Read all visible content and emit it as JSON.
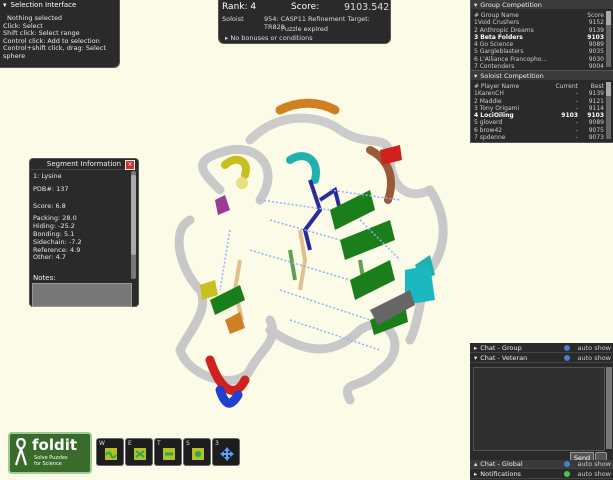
{
  "selection": {
    "title": "Selection Interface",
    "lines": [
      "Nothing selected",
      "Click: Select",
      "Shift click: Select range",
      "Control click: Add to selection",
      "Control+shift click, drag: Select",
      "sphere"
    ]
  },
  "score": {
    "rank": "Rank: 4",
    "score_label": "Score:",
    "score_value": "9103.542",
    "soloist": "Soloist",
    "target": "954: CASP11 Refinement Target: TR828",
    "status": "Puzzle expired",
    "bonus": "No bonuses or conditions"
  },
  "segment": {
    "title": "Segment Information",
    "residue": "1: Lysine",
    "pdb": "PDB#:   137",
    "score": "Score: 6.8",
    "packing": "Packing: 28.0",
    "hiding": "Hiding: -25.2",
    "bonding": "Bonding: 5.1",
    "sidechain": "Sidechain: -7.2",
    "reference": "Reference: 4.9",
    "other": "Other: 4.7",
    "notes_label": "Notes:"
  },
  "group": {
    "title": "Group Competition",
    "headers": [
      "# Group Name",
      "Score"
    ],
    "rows": [
      [
        "1Void Crushers",
        "9152"
      ],
      [
        "2 Anthropic Dreams",
        "9139"
      ],
      [
        "3 Beta Folders",
        "9103"
      ],
      [
        "4 Go Science",
        "9089"
      ],
      [
        "5 Gargleblasters",
        "9035"
      ],
      [
        "6 L'Alliance Francopho...",
        "9030"
      ],
      [
        "7 Contenders",
        "9004"
      ]
    ]
  },
  "solo": {
    "title": "Soloist Competition",
    "headers": [
      "# Player Name",
      "Current",
      "Best"
    ],
    "rows": [
      [
        "1KarenCH",
        "-",
        "9139"
      ],
      [
        "2 Maddie",
        "-",
        "9121"
      ],
      [
        "3 Tony Origami",
        "-",
        "9114"
      ],
      [
        "4 LociOiling",
        "9103",
        "9103"
      ],
      [
        "5 gloverd",
        "-",
        "9089"
      ],
      [
        "6 brow42",
        "-",
        "9075"
      ],
      [
        "7 spdenne",
        "-",
        "9073"
      ]
    ]
  },
  "chat": {
    "group": "Chat - Group",
    "veteran": "Chat - Veteran",
    "global": "Chat - Global",
    "notifications": "Notifications",
    "auto_show": "auto show",
    "send": "Send"
  },
  "logo": {
    "name": "foldit",
    "tagline": "Solve Puzzles",
    "tagline2": "for Science"
  },
  "tools": [
    {
      "key": "W",
      "icon": "wiggle-icon"
    },
    {
      "key": "E",
      "icon": "shake-icon"
    },
    {
      "key": "T",
      "icon": "tweak-icon"
    },
    {
      "key": "S",
      "icon": "sidechain-shake-icon"
    },
    {
      "key": "3",
      "icon": "move-icon"
    }
  ]
}
